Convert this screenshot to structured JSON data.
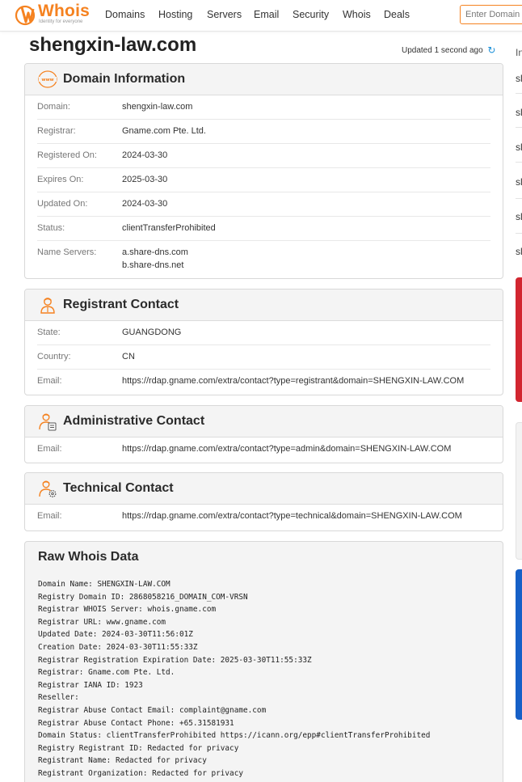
{
  "header": {
    "logo_text": "Whois",
    "logo_tagline": "Identity for everyone",
    "nav": [
      "Domains",
      "Hosting",
      "Servers",
      "Email",
      "Security",
      "Whois",
      "Deals"
    ],
    "search_placeholder": "Enter Domain"
  },
  "page": {
    "title": "shengxin-law.com",
    "updated": "Updated 1 second ago"
  },
  "domain_info": {
    "heading": "Domain Information",
    "rows": [
      {
        "label": "Domain:",
        "value": "shengxin-law.com"
      },
      {
        "label": "Registrar:",
        "value": "Gname.com Pte. Ltd."
      },
      {
        "label": "Registered On:",
        "value": "2024-03-30"
      },
      {
        "label": "Expires On:",
        "value": "2025-03-30"
      },
      {
        "label": "Updated On:",
        "value": "2024-03-30"
      },
      {
        "label": "Status:",
        "value": "clientTransferProhibited"
      },
      {
        "label": "Name Servers:",
        "value": "a.share-dns.com",
        "value2": "b.share-dns.net"
      }
    ]
  },
  "registrant": {
    "heading": "Registrant Contact",
    "rows": [
      {
        "label": "State:",
        "value": "GUANGDONG"
      },
      {
        "label": "Country:",
        "value": "CN"
      },
      {
        "label": "Email:",
        "value": "https://rdap.gname.com/extra/contact?type=registrant&domain=SHENGXIN-LAW.COM"
      }
    ]
  },
  "admin": {
    "heading": "Administrative Contact",
    "rows": [
      {
        "label": "Email:",
        "value": "https://rdap.gname.com/extra/contact?type=admin&domain=SHENGXIN-LAW.COM"
      }
    ]
  },
  "technical": {
    "heading": "Technical Contact",
    "rows": [
      {
        "label": "Email:",
        "value": "https://rdap.gname.com/extra/contact?type=technical&domain=SHENGXIN-LAW.COM"
      }
    ]
  },
  "raw": {
    "heading": "Raw Whois Data",
    "lines": [
      "Domain Name: SHENGXIN-LAW.COM",
      "Registry Domain ID: 2868058216_DOMAIN_COM-VRSN",
      "Registrar WHOIS Server: whois.gname.com",
      "Registrar URL: www.gname.com",
      "Updated Date: 2024-03-30T11:56:01Z",
      "Creation Date: 2024-03-30T11:55:33Z",
      "Registrar Registration Expiration Date: 2025-03-30T11:55:33Z",
      "Registrar: Gname.com Pte. Ltd.",
      "Registrar IANA ID: 1923",
      "Reseller:",
      "Registrar Abuse Contact Email: complaint@gname.com",
      "Registrar Abuse Contact Phone: +65.31581931",
      "Domain Status: clientTransferProhibited https://icann.org/epp#clientTransferProhibited",
      "Registry Registrant ID: Redacted for privacy",
      "Registrant Name: Redacted for privacy",
      "Registrant Organization: Redacted for privacy"
    ]
  },
  "sidebar": {
    "label": "In",
    "items": [
      "sl",
      "sl",
      "sl",
      "sl",
      "sl",
      "sl"
    ]
  },
  "colors": {
    "brand": "#f58220",
    "refresh": "#1a8fd8",
    "side_red": "#d22630",
    "side_blue": "#1660c7"
  }
}
